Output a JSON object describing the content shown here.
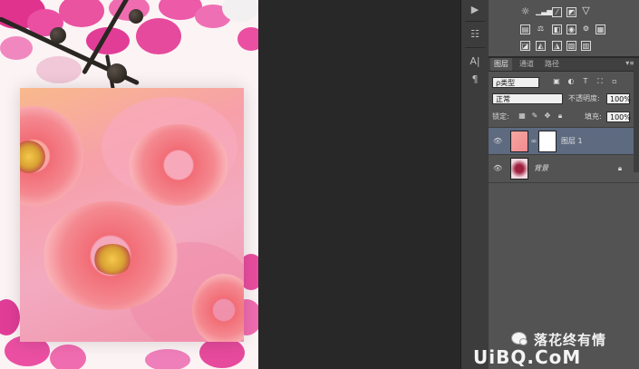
{
  "layers_panel": {
    "tabs": [
      {
        "label": "图层",
        "active": true
      },
      {
        "label": "通道",
        "active": false
      },
      {
        "label": "路径",
        "active": false
      }
    ],
    "filter_kind": "ρ类型",
    "blend_mode": "正常",
    "opacity_label": "不透明度:",
    "opacity_value": "100%",
    "lock_label": "锁定:",
    "fill_label": "填充:",
    "fill_value": "100%",
    "layers": [
      {
        "name": "图层 1",
        "selected": true,
        "has_mask": true,
        "locked": false
      },
      {
        "name": "背景",
        "selected": false,
        "has_mask": false,
        "locked": true
      }
    ]
  },
  "watermark": {
    "author": "落花终有情",
    "site": "UiBQ.CoM"
  },
  "colors": {
    "workspace": "#282828",
    "panel": "#535353",
    "selected_layer": "#5d6a80"
  }
}
